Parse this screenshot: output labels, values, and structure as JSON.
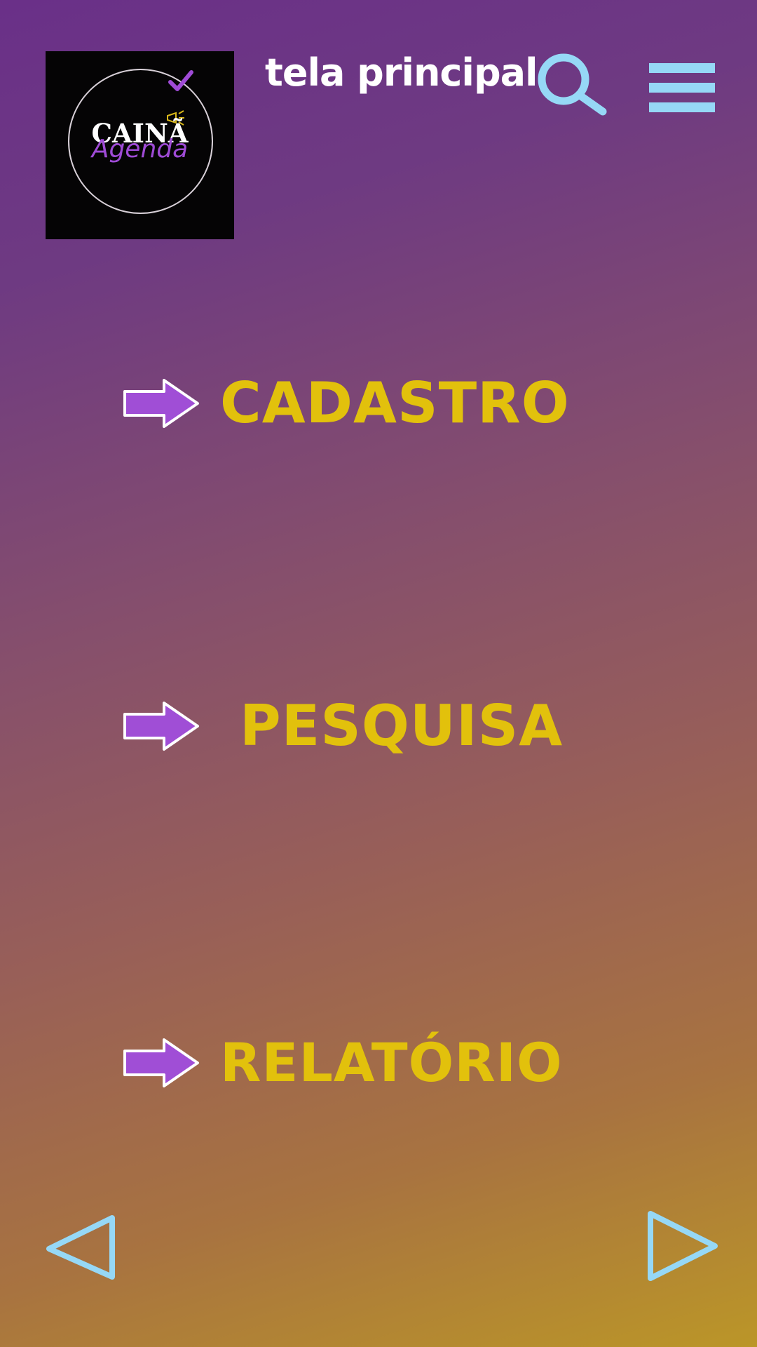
{
  "logo": {
    "title": "CAINÃ",
    "subtitle": "Agenda",
    "icons": [
      "check-icon",
      "megaphone-icon"
    ]
  },
  "header": {
    "title": "tela principal",
    "search_icon": "search-icon",
    "menu_icon": "hamburger-menu-icon"
  },
  "menu_items": [
    {
      "label": "CADASTRO",
      "icon": "arrow-right-icon"
    },
    {
      "label": "PESQUISA",
      "icon": "arrow-right-icon"
    },
    {
      "label": "RELATÓRIO",
      "icon": "arrow-right-icon"
    }
  ],
  "navigation": {
    "previous_icon": "triangle-left-icon",
    "next_icon": "triangle-right-icon"
  },
  "colors": {
    "gradient_top": "#6a3088",
    "gradient_bottom": "#bb9628",
    "menu_text": "#e2c10c",
    "arrow_fill": "#a04ed6",
    "icon_accent": "#96d8f6",
    "title_text": "#ffffff"
  }
}
